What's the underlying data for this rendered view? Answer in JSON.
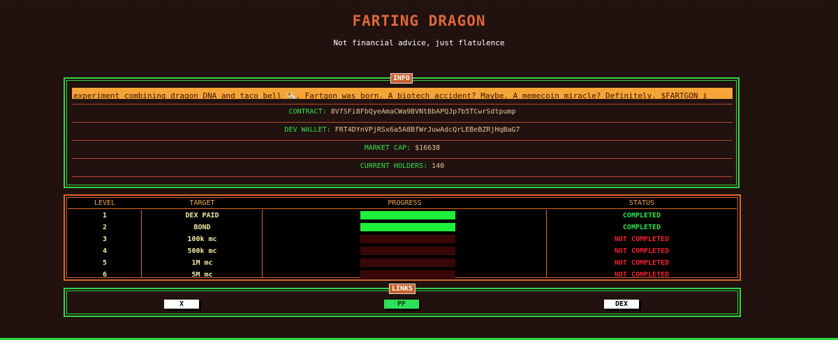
{
  "header": {
    "title": "FARTING DRAGON",
    "subtitle": "Not financial advice, just flatulence"
  },
  "info": {
    "legend": "INFO",
    "ticker": "experiment combining dragon DNA and taco bell 🌯, Fartgon was born. A biotech accident? Maybe. A memecoin miracle? Definitely. $FARTGON i",
    "contract_label": "CONTRACT:",
    "contract_value": "8VfSFi8FbQyeAmaCWa9BVNtBbAPQJp7b5TCwrSdtpump",
    "dev_wallet_label": "DEV WALLET:",
    "dev_wallet_value": "FRT4DYnVPjRSx6a5A8BfWrJuwAdcQrLEBeBZRjHqBaG7",
    "market_cap_label": "MARKET CAP:",
    "market_cap_value": "$16638",
    "holders_label": "CURRENT HOLDERS:",
    "holders_value": "140"
  },
  "levels": {
    "headers": [
      "LEVEL",
      "TARGET",
      "PROGRESS",
      "STATUS"
    ],
    "rows": [
      {
        "level": "1",
        "target": "DEX PAID",
        "progress": 1.0,
        "status": "COMPLETED"
      },
      {
        "level": "2",
        "target": "BOND",
        "progress": 1.0,
        "status": "COMPLETED"
      },
      {
        "level": "3",
        "target": "100k mc",
        "progress": 0.0,
        "status": "NOT COMPLETED"
      },
      {
        "level": "4",
        "target": "500k mc",
        "progress": 0.0,
        "status": "NOT COMPLETED"
      },
      {
        "level": "5",
        "target": "1M mc",
        "progress": 0.0,
        "status": "NOT COMPLETED"
      },
      {
        "level": "6",
        "target": "5M mc",
        "progress": 0.0,
        "status": "NOT COMPLETED"
      }
    ]
  },
  "links": {
    "legend": "LINKS",
    "x_label": "X",
    "pf_label": "PF",
    "dex_label": "DEX"
  },
  "colors": {
    "completed": "#2ce04a",
    "not_completed": "#f0202a",
    "progress_fill": "#1df23a",
    "accent_orange": "#e06a2a",
    "panel_green": "#2dd63f"
  }
}
